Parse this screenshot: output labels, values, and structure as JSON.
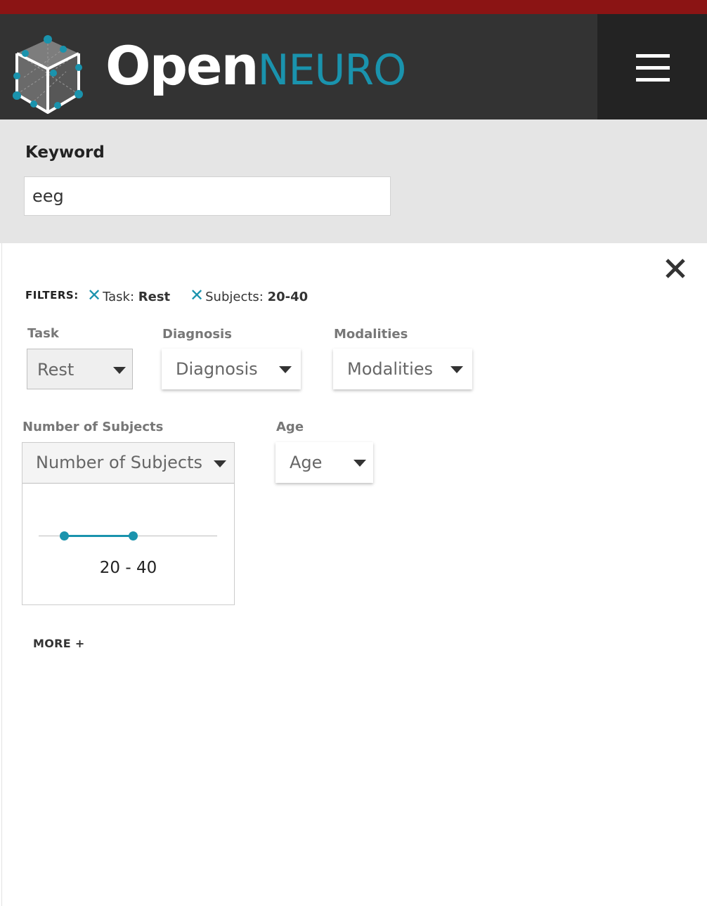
{
  "brand": {
    "open": "Open",
    "neuro": "NEURO"
  },
  "colors": {
    "accent": "#1a93ad",
    "header_bg": "#333333",
    "top_strip": "#8b1414"
  },
  "header": {
    "menu_icon": "hamburger-icon"
  },
  "keyword": {
    "label": "Keyword",
    "value": "eeg"
  },
  "filters": {
    "label": "FILTERS:",
    "active": [
      {
        "name": "Task:",
        "value": "Rest"
      },
      {
        "name": "Subjects:",
        "value": "20-40"
      }
    ]
  },
  "fields": {
    "task": {
      "label": "Task",
      "value": "Rest"
    },
    "diagnosis": {
      "label": "Diagnosis",
      "placeholder": "Diagnosis"
    },
    "modalities": {
      "label": "Modalities",
      "placeholder": "Modalities"
    },
    "subjects": {
      "label": "Number of Subjects",
      "placeholder": "Number of Subjects",
      "range_text": "20 - 40",
      "range_min": 20,
      "range_max": 40
    },
    "age": {
      "label": "Age",
      "placeholder": "Age"
    }
  },
  "more": {
    "label": "MORE",
    "icon": "+"
  }
}
